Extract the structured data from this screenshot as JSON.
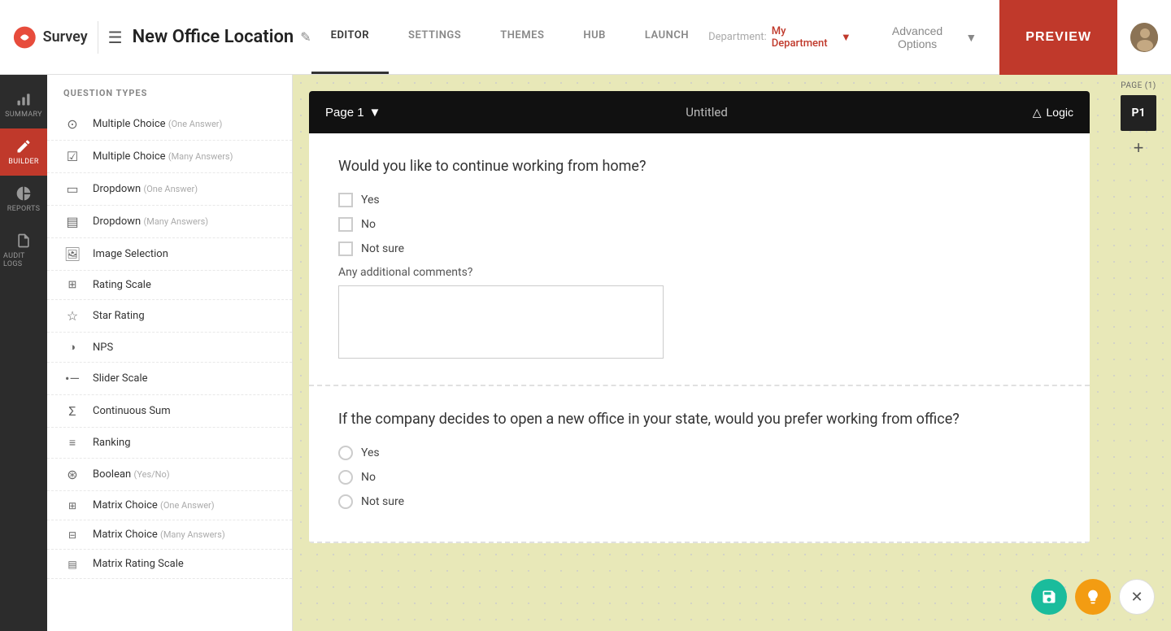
{
  "app": {
    "logo_text": "Survey",
    "title": "New Office Location"
  },
  "header": {
    "department_label": "Department:",
    "department_name": "My Department",
    "tabs": [
      {
        "id": "editor",
        "label": "EDITOR",
        "active": true
      },
      {
        "id": "settings",
        "label": "SETTINGS",
        "active": false
      },
      {
        "id": "themes",
        "label": "THEMES",
        "active": false
      },
      {
        "id": "hub",
        "label": "HUB",
        "active": false
      },
      {
        "id": "launch",
        "label": "LAUNCH",
        "active": false
      }
    ],
    "advanced_options_label": "Advanced Options",
    "preview_label": "PREVIEW"
  },
  "sidebar": {
    "items": [
      {
        "id": "summary",
        "label": "SUMMARY",
        "icon": "chart"
      },
      {
        "id": "builder",
        "label": "BUILDER",
        "icon": "edit",
        "active": true
      },
      {
        "id": "reports",
        "label": "REPORTS",
        "icon": "pie"
      },
      {
        "id": "audit-logs",
        "label": "AUDIT LOGS",
        "icon": "doc"
      }
    ]
  },
  "question_types": {
    "header": "Question Types",
    "items": [
      {
        "id": "mc-one",
        "label": "Multiple Choice",
        "sub": "One Answer",
        "icon": "radio"
      },
      {
        "id": "mc-many",
        "label": "Multiple Choice",
        "sub": "Many Answers",
        "icon": "checkbox"
      },
      {
        "id": "dd-one",
        "label": "Dropdown",
        "sub": "One Answer",
        "icon": "dropdown"
      },
      {
        "id": "dd-many",
        "label": "Dropdown",
        "sub": "Many Answers",
        "icon": "dropdown-many"
      },
      {
        "id": "img-sel",
        "label": "Image Selection",
        "sub": "",
        "icon": "image"
      },
      {
        "id": "rating",
        "label": "Rating Scale",
        "sub": "",
        "icon": "rating"
      },
      {
        "id": "star",
        "label": "Star Rating",
        "sub": "",
        "icon": "star"
      },
      {
        "id": "nps",
        "label": "NPS",
        "sub": "",
        "icon": "nps"
      },
      {
        "id": "slider",
        "label": "Slider Scale",
        "sub": "",
        "icon": "slider"
      },
      {
        "id": "cont-sum",
        "label": "Continuous Sum",
        "sub": "",
        "icon": "sigma"
      },
      {
        "id": "ranking",
        "label": "Ranking",
        "sub": "",
        "icon": "bars"
      },
      {
        "id": "boolean",
        "label": "Boolean",
        "sub": "Yes/No",
        "icon": "bool"
      },
      {
        "id": "matrix-one",
        "label": "Matrix Choice",
        "sub": "One Answer",
        "icon": "matrix"
      },
      {
        "id": "matrix-many",
        "label": "Matrix Choice",
        "sub": "Many Answers",
        "icon": "matrix-many"
      },
      {
        "id": "matrix-rating",
        "label": "Matrix Rating Scale",
        "sub": "",
        "icon": "matrix-rating"
      }
    ]
  },
  "page": {
    "label": "Page 1",
    "name": "Untitled",
    "logic_label": "Logic",
    "indicator_label": "PAGE (1)",
    "indicator_id": "P1"
  },
  "questions": [
    {
      "id": "q1",
      "text": "Would you like to continue working from home?",
      "type": "checkbox",
      "options": [
        "Yes",
        "No",
        "Not sure"
      ],
      "comment_label": "Any additional comments?",
      "has_comment": true
    },
    {
      "id": "q2",
      "text": "If the company decides to open a new office in your state, would you prefer working from office?",
      "type": "radio",
      "options": [
        "Yes",
        "No",
        "Not sure"
      ],
      "has_comment": false
    }
  ],
  "floating": {
    "save_icon": "save",
    "bulb_icon": "bulb",
    "close_icon": "close"
  }
}
